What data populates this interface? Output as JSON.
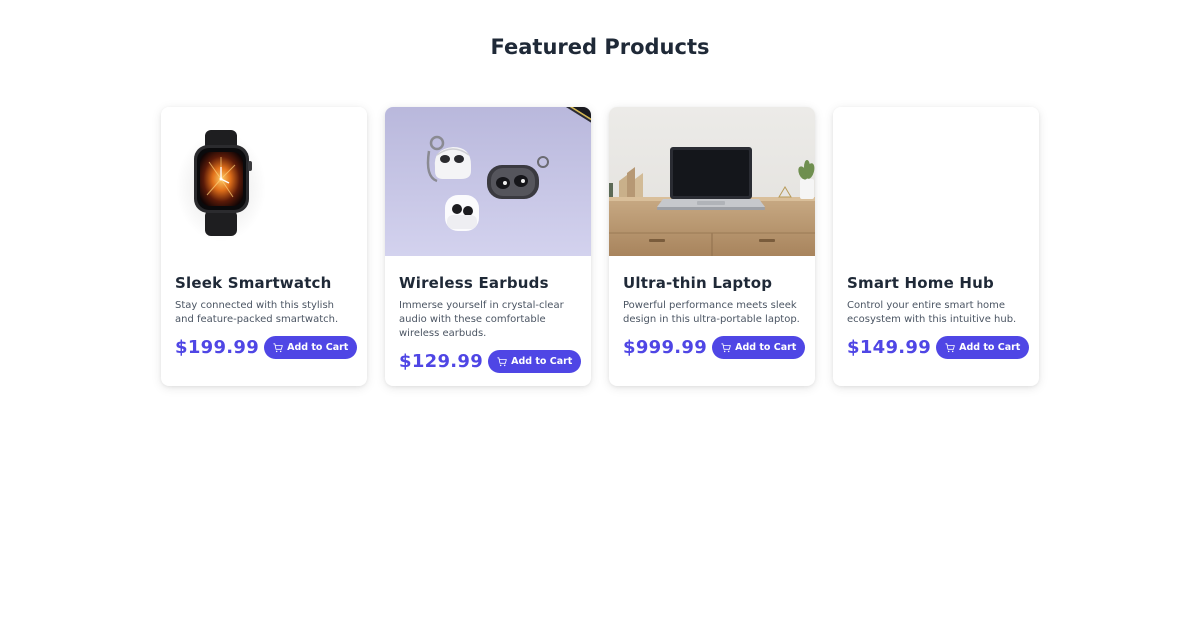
{
  "page": {
    "title": "Featured Products"
  },
  "products": [
    {
      "title": "Sleek Smartwatch",
      "description": "Stay connected with this stylish and feature-packed smartwatch.",
      "price": "$199.99",
      "button_label": "Add to Cart",
      "image_icon": "smartwatch-image"
    },
    {
      "title": "Wireless Earbuds",
      "description": "Immerse yourself in crystal-clear audio with these comfortable wireless earbuds.",
      "price": "$129.99",
      "button_label": "Add to Cart",
      "image_icon": "earbuds-image"
    },
    {
      "title": "Ultra-thin Laptop",
      "description": "Powerful performance meets sleek design in this ultra-portable laptop.",
      "price": "$999.99",
      "button_label": "Add to Cart",
      "image_icon": "laptop-image"
    },
    {
      "title": "Smart Home Hub",
      "description": "Control your entire smart home ecosystem with this intuitive hub.",
      "price": "$149.99",
      "button_label": "Add to Cart",
      "image_icon": "smart-home-hub-image"
    }
  ],
  "colors": {
    "accent": "#4f46e5",
    "heading": "#1f2937",
    "body_text": "#4b5563"
  }
}
